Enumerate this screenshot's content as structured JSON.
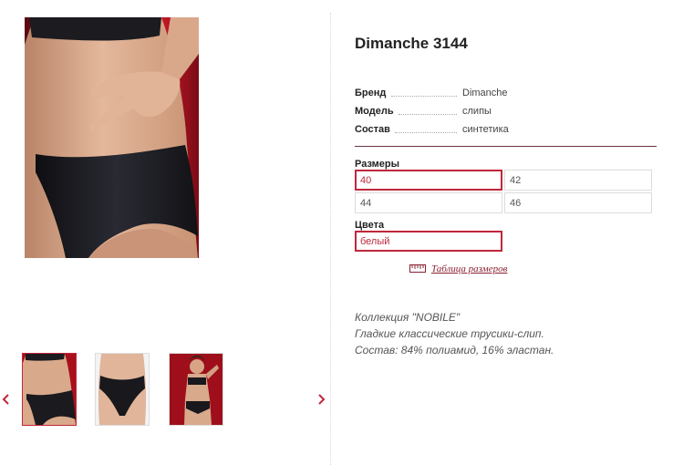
{
  "product": {
    "title": "Dimanche 3144"
  },
  "specs": [
    {
      "label": "Бренд",
      "value": "Dimanche"
    },
    {
      "label": "Модель",
      "value": "слипы"
    },
    {
      "label": "Состав",
      "value": "синтетика"
    }
  ],
  "sizes": {
    "label": "Размеры",
    "options": [
      "40",
      "42",
      "44",
      "46"
    ],
    "selected": "40"
  },
  "colors": {
    "label": "Цвета",
    "options": [
      "белый"
    ],
    "selected": "белый"
  },
  "size_table_link": "Таблица размеров",
  "description": [
    "Коллекция \"NOBILE\"",
    "Гладкие классические трусики-слип.",
    "Состав: 84% полиамид, 16% эластан."
  ],
  "gallery": {
    "thumbnails": [
      {
        "icon": "front-view-photo",
        "active": true
      },
      {
        "icon": "brief-closeup-photo",
        "active": false
      },
      {
        "icon": "full-set-photo",
        "active": false
      }
    ]
  },
  "colors_palette": {
    "accent": "#c0273b",
    "curtain_red": "#b0101e",
    "garment_black": "#1a1a1f",
    "skin": "#d8a98c"
  }
}
